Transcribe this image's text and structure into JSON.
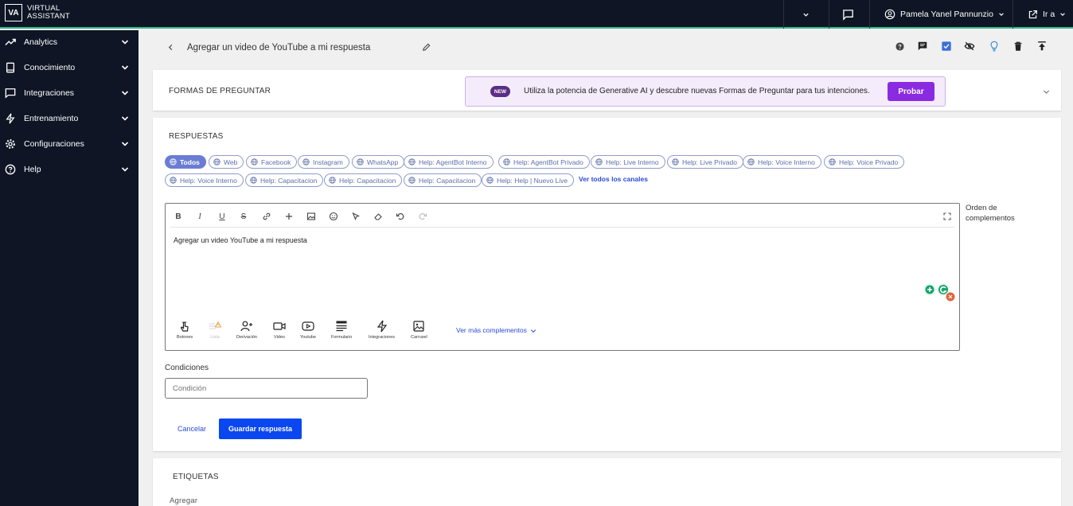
{
  "topbar": {
    "logo_abbr": "VA",
    "logo_line1": "VIRTUAL",
    "logo_line2": "ASSISTANT",
    "user_name": "Pamela Yanel Pannunzio",
    "goto_label": "Ir a"
  },
  "sidebar": {
    "items": [
      {
        "label": "Analytics",
        "icon": "trending-up-icon"
      },
      {
        "label": "Conocimiento",
        "icon": "book-icon"
      },
      {
        "label": "Integraciones",
        "icon": "chat-icon"
      },
      {
        "label": "Entrenamiento",
        "icon": "bolt-icon"
      },
      {
        "label": "Configuraciones",
        "icon": "gear-icon"
      },
      {
        "label": "Help",
        "icon": "help-icon"
      }
    ]
  },
  "header": {
    "title": "Agregar un video de YouTube a mi respuesta"
  },
  "formas": {
    "title": "FORMAS DE PREGUNTAR",
    "promo_badge": "NEW",
    "promo_text": "Utiliza la potencia de Generative AI y descubre nuevas Formas de Preguntar para tus intenciones.",
    "promo_button": "Probar"
  },
  "respuestas": {
    "title": "RESPUESTAS",
    "channels": [
      "Todos",
      "Web",
      "Facebook",
      "Instagram",
      "WhatsApp",
      "Help: AgentBot Interno",
      "Help: AgentBot Privado",
      "Help: Live Interno",
      "Help: Live Privado",
      "Help: Voice Interno",
      "Help: Voice Privado",
      "Help: Voice Interno",
      "Help: Capacitacion",
      "Help: Capacitacion",
      "Help: Capacitacion",
      "Help: Help | Nuevo Live"
    ],
    "view_all_channels": "Ver todos los canales",
    "editor_text": "Agregar un video YouTube a mi respuesta",
    "components": [
      "Botones",
      "Lista",
      "Derivación",
      "Video",
      "Youtube",
      "Formulario",
      "Integraciones",
      "Carrusel"
    ],
    "more_components": "Ver más complementos",
    "order_label_1": "Orden de",
    "order_label_2": "complementos",
    "conditions_label": "Condiciones",
    "condition_placeholder": "Condición",
    "cancel": "Cancelar",
    "save": "Guardar respuesta"
  },
  "etiquetas": {
    "title": "ETIQUETAS",
    "add_label": "Agregar"
  },
  "colors": {
    "sidebar_bg": "#0f1525",
    "accent_green": "#2fbf8f",
    "primary_blue": "#0b47f0",
    "promo_purple": "#8a2be2"
  }
}
